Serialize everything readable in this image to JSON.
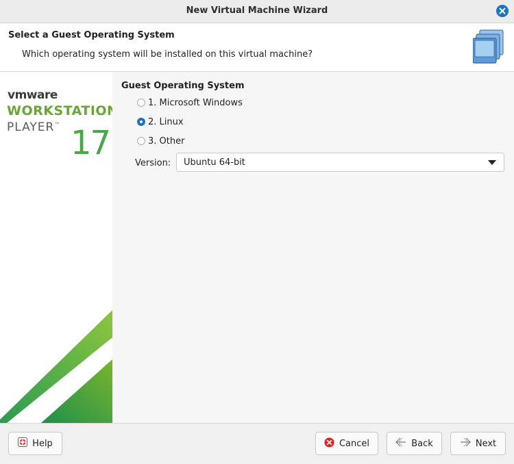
{
  "window": {
    "title": "New Virtual Machine Wizard"
  },
  "header": {
    "title": "Select a Guest Operating System",
    "subtitle": "Which operating system will be installed on this virtual machine?"
  },
  "branding": {
    "vendor": "vmware",
    "product_line1": "WORKSTATION",
    "product_line2": "PLAYER",
    "trademark": "™",
    "version": "17",
    "colors": {
      "green": "#6aa637",
      "dark_green": "#2e8b3c",
      "gray": "#5a5a5a"
    }
  },
  "form": {
    "group_label": "Guest Operating System",
    "options": [
      {
        "label": "1. Microsoft Windows",
        "checked": false
      },
      {
        "label": "2. Linux",
        "checked": true
      },
      {
        "label": "3. Other",
        "checked": false
      }
    ],
    "version_label": "Version:",
    "version_value": "Ubuntu 64-bit"
  },
  "footer": {
    "help_label": "Help",
    "cancel_label": "Cancel",
    "back_label": "Back",
    "next_label": "Next"
  },
  "icons": {
    "close": "close-icon",
    "vm_stack": "vm-stack-icon",
    "help": "help-icon",
    "cancel": "cancel-icon",
    "back": "back-arrow-icon",
    "next": "next-arrow-icon"
  },
  "accent": "#1a73c7"
}
